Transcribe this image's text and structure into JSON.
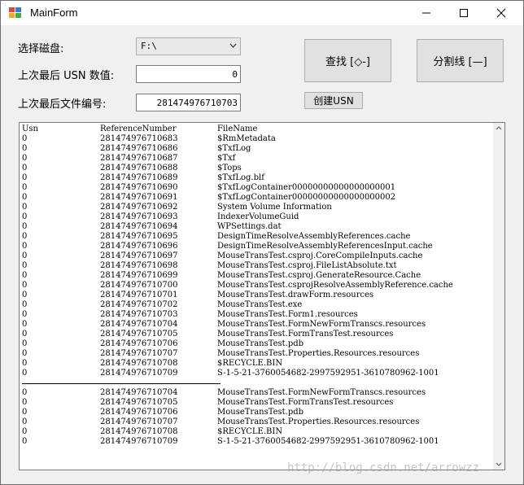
{
  "window": {
    "title": "MainForm",
    "icon": "app-icon"
  },
  "form": {
    "drive_label": "选择磁盘:",
    "drive_value": "F:\\",
    "last_usn_label": "上次最后 USN 数值:",
    "last_usn_value": "0",
    "last_file_no_label": "上次最后文件编号:",
    "last_file_no_value": "281474976710703",
    "find_button": "查找 [◇-]",
    "divider_button": "分割线 [—]",
    "create_usn_button": "创建USN"
  },
  "list": {
    "headers": [
      "Usn",
      "ReferenceNumber",
      "FileName"
    ],
    "rows_before": [
      [
        "0",
        "281474976710683",
        "$RmMetadata"
      ],
      [
        "0",
        "281474976710686",
        "$TxfLog"
      ],
      [
        "0",
        "281474976710687",
        "$Txf"
      ],
      [
        "0",
        "281474976710688",
        "$Tops"
      ],
      [
        "0",
        "281474976710689",
        "$TxfLog.blf"
      ],
      [
        "0",
        "281474976710690",
        "$TxfLogContainer00000000000000000001"
      ],
      [
        "0",
        "281474976710691",
        "$TxfLogContainer00000000000000000002"
      ],
      [
        "0",
        "281474976710692",
        "System Volume Information"
      ],
      [
        "0",
        "281474976710693",
        "IndexerVolumeGuid"
      ],
      [
        "0",
        "281474976710694",
        "WPSettings.dat"
      ],
      [
        "0",
        "281474976710695",
        "DesignTimeResolveAssemblyReferences.cache"
      ],
      [
        "0",
        "281474976710696",
        "DesignTimeResolveAssemblyReferencesInput.cache"
      ],
      [
        "0",
        "281474976710697",
        "MouseTransTest.csproj.CoreCompileInputs.cache"
      ],
      [
        "0",
        "281474976710698",
        "MouseTransTest.csproj.FileListAbsolute.txt"
      ],
      [
        "0",
        "281474976710699",
        "MouseTransTest.csproj.GenerateResource.Cache"
      ],
      [
        "0",
        "281474976710700",
        "MouseTransTest.csprojResolveAssemblyReference.cache"
      ],
      [
        "0",
        "281474976710701",
        "MouseTransTest.drawForm.resources"
      ],
      [
        "0",
        "281474976710702",
        "MouseTransTest.exe"
      ],
      [
        "0",
        "281474976710703",
        "MouseTransTest.Form1.resources"
      ],
      [
        "0",
        "281474976710704",
        "MouseTransTest.FormNewFormTranscs.resources"
      ],
      [
        "0",
        "281474976710705",
        "MouseTransTest.FormTransTest.resources"
      ],
      [
        "0",
        "281474976710706",
        "MouseTransTest.pdb"
      ],
      [
        "0",
        "281474976710707",
        "MouseTransTest.Properties.Resources.resources"
      ],
      [
        "0",
        "281474976710708",
        "$RECYCLE.BIN"
      ],
      [
        "0",
        "281474976710709",
        "S-1-5-21-3760054682-2997592951-3610780962-1001"
      ]
    ],
    "rows_after": [
      [
        "0",
        "281474976710704",
        "MouseTransTest.FormNewFormTranscs.resources"
      ],
      [
        "0",
        "281474976710705",
        "MouseTransTest.FormTransTest.resources"
      ],
      [
        "0",
        "281474976710706",
        "MouseTransTest.pdb"
      ],
      [
        "0",
        "281474976710707",
        "MouseTransTest.Properties.Resources.resources"
      ],
      [
        "0",
        "281474976710708",
        "$RECYCLE.BIN"
      ],
      [
        "0",
        "281474976710709",
        "S-1-5-21-3760054682-2997592951-3610780962-1001"
      ]
    ]
  },
  "watermark": "http://blog.csdn.net/arrowzz"
}
